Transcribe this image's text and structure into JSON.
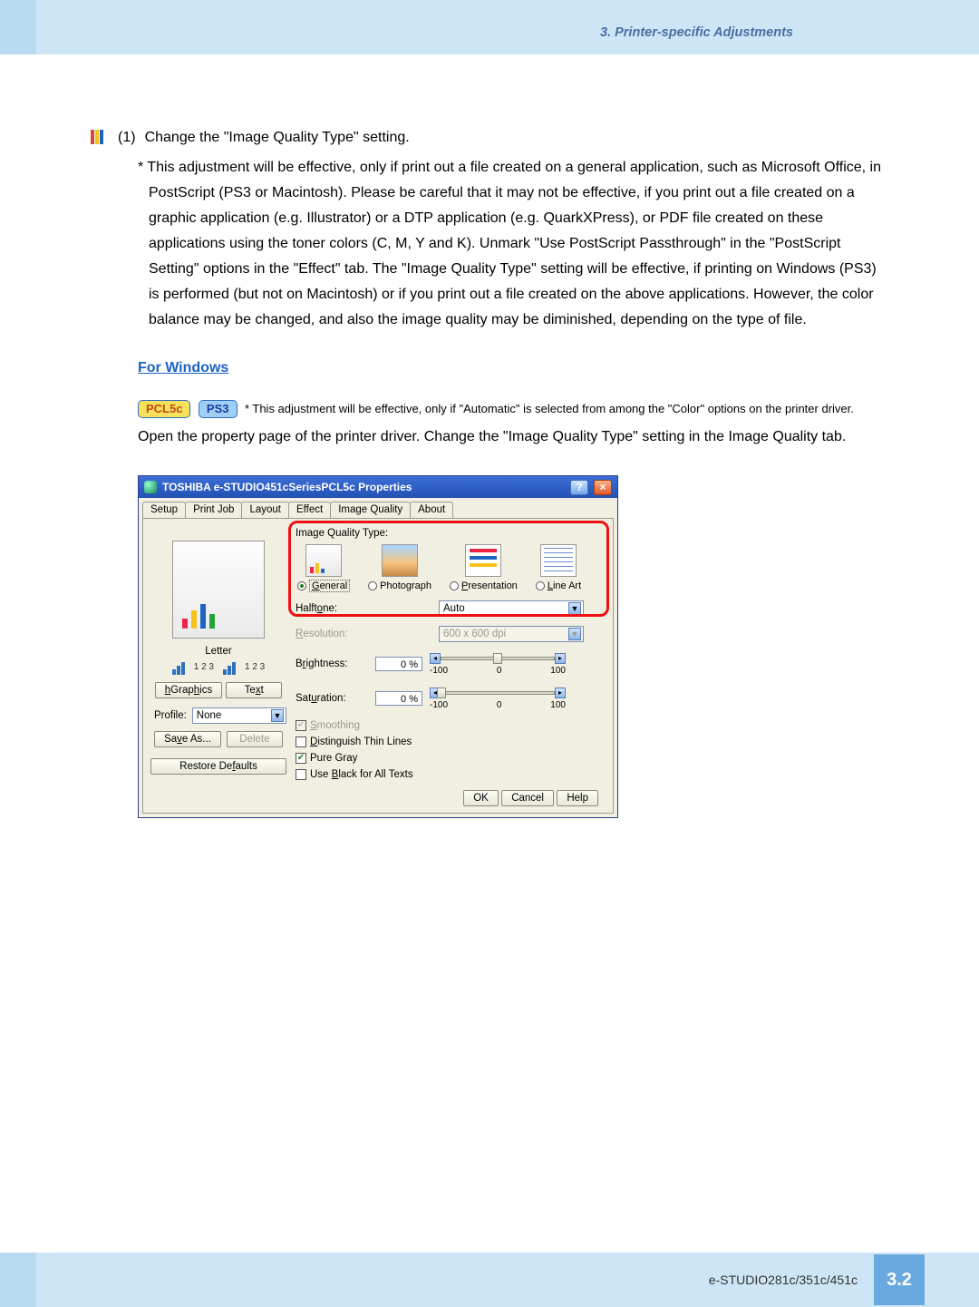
{
  "header": {
    "section_title": "3. Printer-specific Adjustments"
  },
  "step": {
    "number": "(1)",
    "text": "Change the \"Image Quality Type\" setting.",
    "note": "* This adjustment will be effective, only if print out a file created on a general application, such as Microsoft Office, in PostScript (PS3 or Macintosh).  Please be careful that it may not be effective, if you print out a file created on a graphic application (e.g. Illustrator) or a DTP application (e.g. QuarkXPress), or PDF file created on these applications using the toner colors (C, M, Y and K).  Unmark \"Use PostScript Passthrough\" in the \"PostScript Setting\" options in the \"Effect\" tab.  The \"Image Quality Type\" setting will be effective, if printing on Windows (PS3) is performed (but not on Macintosh) or if you print out a file created on the above applications.  However, the color balance may be changed, and also the image quality may be diminished, depending on the type of file."
  },
  "for_windows": "For Windows",
  "badges": {
    "pcl": "PCL5c",
    "ps": "PS3",
    "note": "* This adjustment will be effective, only if \"Automatic\" is selected from among the \"Color\" options on the printer driver."
  },
  "open_prop": "Open the property page of the printer driver.  Change the \"Image Quality Type\" setting in the Image Quality tab.",
  "dialog": {
    "title": "TOSHIBA e-STUDIO451cSeriesPCL5c Properties",
    "tabs": [
      "Setup",
      "Print Job",
      "Layout",
      "Effect",
      "Image Quality",
      "About"
    ],
    "active_tab": 4,
    "left": {
      "preview_label": "Letter",
      "slider_sample": "1 2 3",
      "graphics_btn": "Graphics",
      "text_btn": "Text",
      "profile_label": "Profile:",
      "profile_value": "None",
      "save_btn": "Save As...",
      "delete_btn": "Delete",
      "restore_btn": "Restore Defaults"
    },
    "right": {
      "iq_label": "Image Quality Type:",
      "opts": {
        "general": "General",
        "photo": "Photograph",
        "pres": "Presentation",
        "line": "Line Art"
      },
      "halftone_label": "Halftone:",
      "halftone_value": "Auto",
      "resolution_label": "Resolution:",
      "resolution_value": "600 x 600 dpi",
      "brightness_label": "Brightness:",
      "brightness_value": "0 %",
      "saturation_label": "Saturation:",
      "saturation_value": "0 %",
      "slider_min": "-100",
      "slider_mid": "0",
      "slider_max": "100",
      "smoothing": "Smoothing",
      "thin_lines": "Distinguish Thin Lines",
      "pure_gray": "Pure Gray",
      "use_black": "Use Black for All Texts"
    },
    "buttons": {
      "ok": "OK",
      "cancel": "Cancel",
      "help": "Help"
    }
  },
  "footer": {
    "model": "e-STUDIO281c/351c/451c",
    "page": "3.2"
  }
}
